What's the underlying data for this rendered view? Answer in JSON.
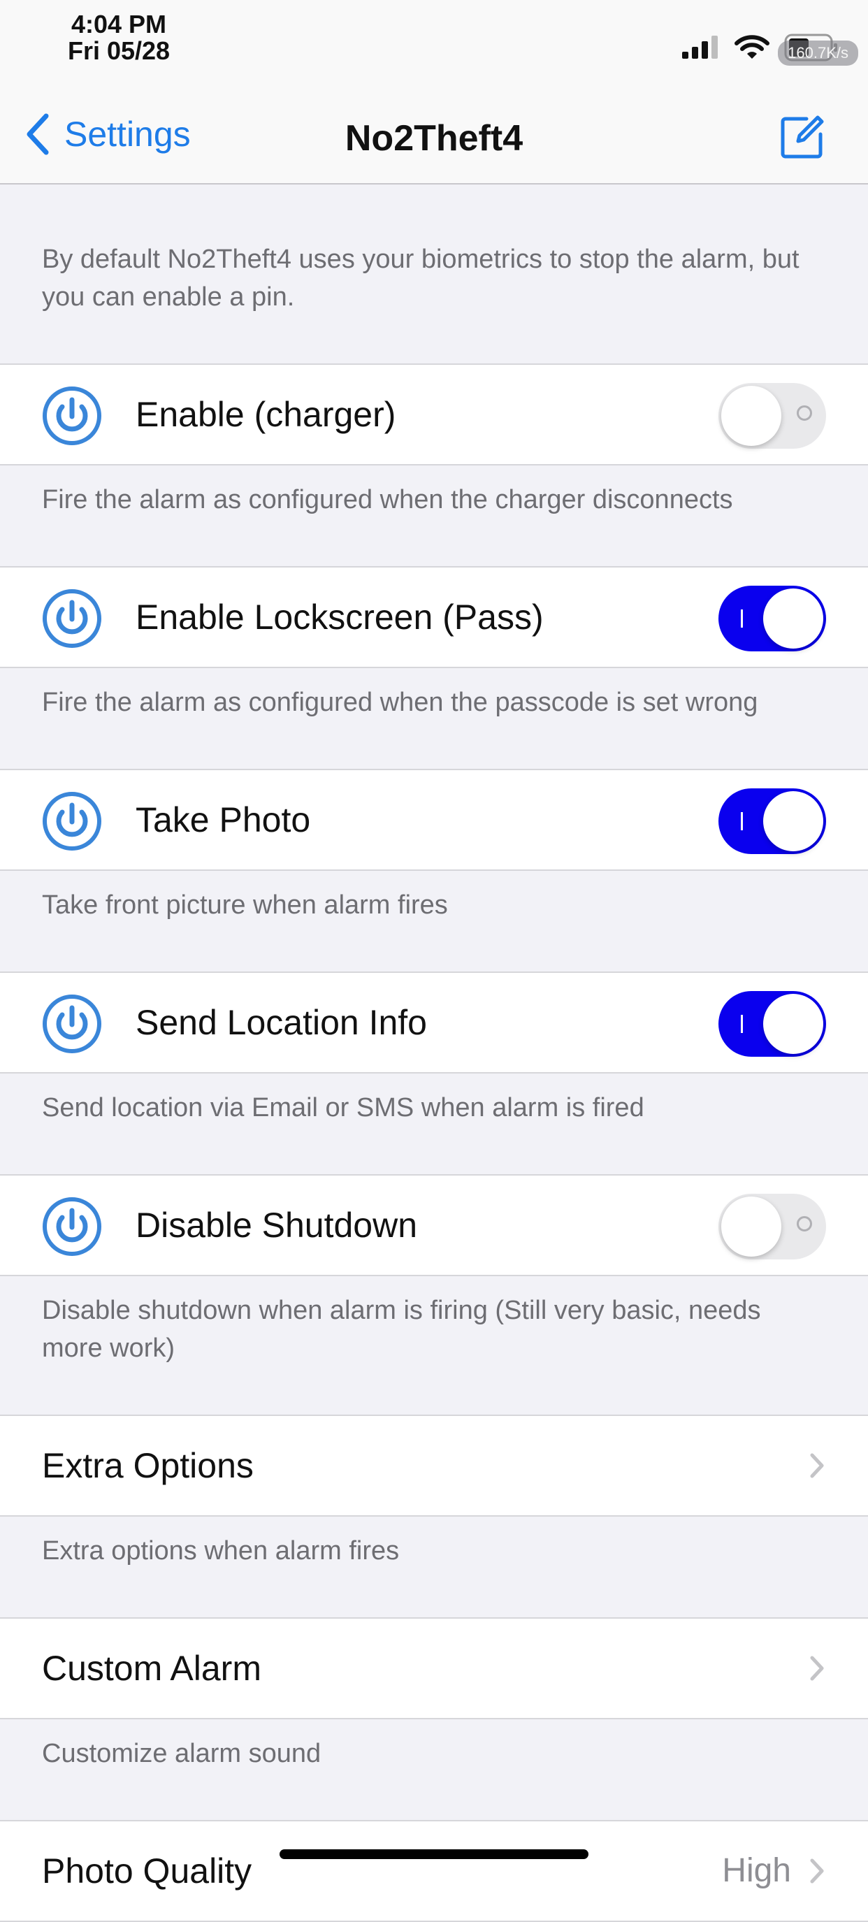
{
  "status_bar": {
    "time": "4:04 PM",
    "date": "Fri 05/28",
    "network_speed": "160.7K/s",
    "icons": [
      "signal-icon",
      "wifi-icon",
      "battery-icon"
    ]
  },
  "nav": {
    "back_label": "Settings",
    "title": "No2Theft4",
    "back_icon": "chevron-left-icon",
    "action_icon": "compose-icon"
  },
  "intro": "By default No2Theft4 uses your biometrics to stop the alarm, but you can enable a pin.",
  "rows": [
    {
      "label": "Enable (charger)",
      "icon": "power-icon",
      "toggle": false,
      "footer": "Fire the alarm as configured when the charger disconnects"
    },
    {
      "label": "Enable Lockscreen (Pass)",
      "icon": "power-icon",
      "toggle": true,
      "footer": "Fire the alarm as configured when the passcode is set wrong"
    },
    {
      "label": "Take Photo",
      "icon": "power-icon",
      "toggle": true,
      "footer": "Take front picture when alarm fires"
    },
    {
      "label": "Send Location Info",
      "icon": "power-icon",
      "toggle": true,
      "footer": "Send location via Email or SMS when alarm is fired"
    },
    {
      "label": "Disable Shutdown",
      "icon": "power-icon",
      "toggle": false,
      "footer": "Disable shutdown when alarm is firing (Still very basic, needs more work)"
    }
  ],
  "links": [
    {
      "label": "Extra Options",
      "footer": "Extra options when alarm fires"
    },
    {
      "label": "Custom Alarm",
      "footer": "Customize alarm sound"
    },
    {
      "label": "Photo Quality",
      "value": "High"
    }
  ],
  "colors": {
    "accent": "#1e7ce8",
    "toggle_on": "#0a00ee",
    "background": "#f2f2f7",
    "secondary_text": "#6d6d72"
  }
}
